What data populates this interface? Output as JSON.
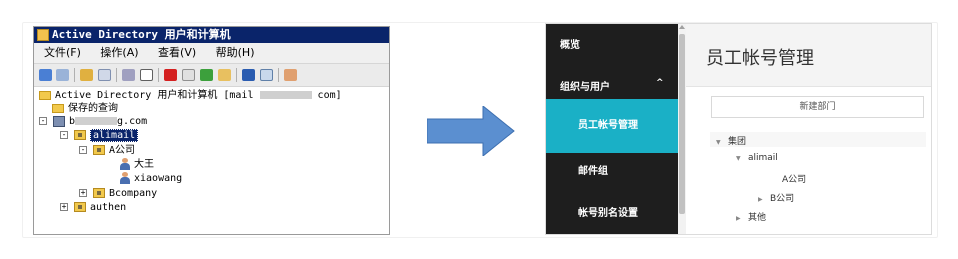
{
  "ad_window": {
    "title": "Active Directory 用户和计算机",
    "menu": [
      "文件(F)",
      "操作(A)",
      "查看(V)",
      "帮助(H)"
    ],
    "tree": {
      "root": "Active Directory 用户和计算机 [mail",
      "root_suffix": "com]",
      "saved_queries": "保存的查询",
      "domain_prefix": "b",
      "domain_suffix": "g.com",
      "selected_ou": "alimail",
      "child_ou": "A公司",
      "user1": "大王",
      "user2": "xiaowang",
      "ou2": "Bcompany",
      "ou3": "authen"
    }
  },
  "admin_panel": {
    "sidebar": {
      "overview": "概览",
      "org_users": "组织与用户",
      "employee_accounts": "员工帐号管理",
      "mail_groups": "邮件组",
      "alias_settings": "帐号别名设置"
    },
    "page_title": "员工帐号管理",
    "new_department_button": "新建部门",
    "tree": {
      "root": "集团",
      "alimail": "alimail",
      "company_a": "A公司",
      "company_b": "B公司",
      "other": "其他"
    }
  },
  "colors": {
    "ad_title_bar": "#0a246a",
    "sidebar_bg": "#1e1e1e",
    "sidebar_active": "#1ab0c6",
    "arrow_fill": "#5b8fd0"
  }
}
